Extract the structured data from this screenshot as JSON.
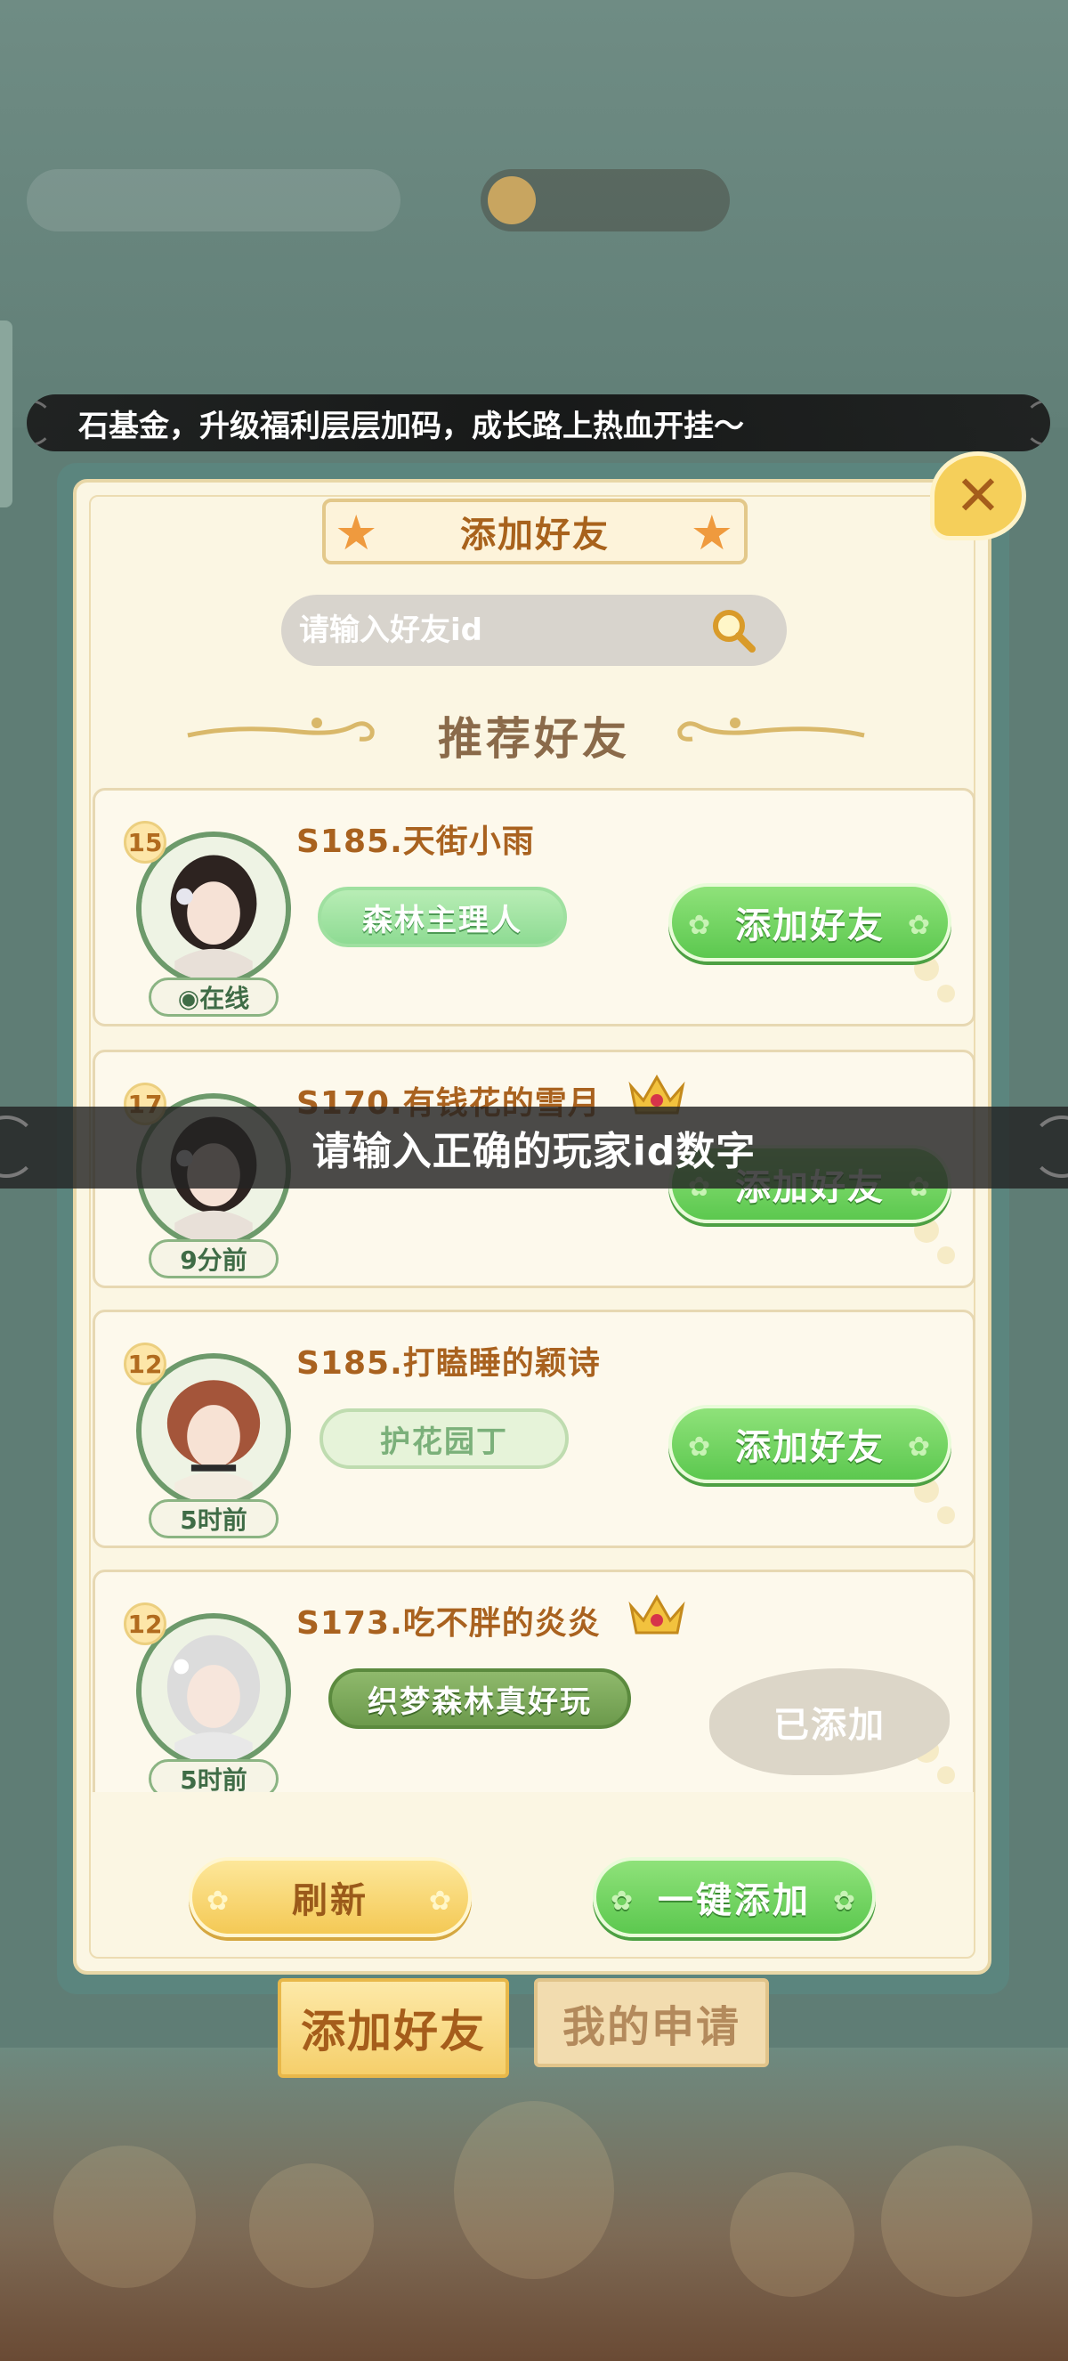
{
  "marquee": {
    "text": "石基金，升级福利层层加码，成长路上热血开挂～"
  },
  "dialog": {
    "title": "添加好友",
    "close_label": "✕",
    "search_placeholder": "请输入好友id",
    "section_title": "推荐好友"
  },
  "friends": [
    {
      "level": "15",
      "name": "S185.天街小雨",
      "title": "森林主理人",
      "status": "◉在线",
      "action": "添加好友",
      "vip": false
    },
    {
      "level": "17",
      "name": "S170.有钱花的雪月",
      "title": "",
      "status": "9分前",
      "action": "添加好友",
      "vip": true
    },
    {
      "level": "12",
      "name": "S185.打瞌睡的颖诗",
      "title": "护花园丁",
      "status": "5时前",
      "action": "添加好友",
      "vip": false
    },
    {
      "level": "12",
      "name": "S173.吃不胖的炎炎",
      "title": "织梦森林真好玩",
      "status": "5时前",
      "action": "已添加",
      "vip": true
    }
  ],
  "buttons": {
    "refresh": "刷新",
    "add_all": "一键添加"
  },
  "tabs": {
    "add_friend": "添加好友",
    "my_requests": "我的申请"
  },
  "toast": {
    "text": "请输入正确的玩家id数字"
  },
  "colors": {
    "accent_green": "#5cc84f",
    "accent_gold": "#f4c955",
    "title_brown": "#a9621f"
  },
  "icons": {
    "search": "search-icon",
    "close": "close-icon",
    "crown": "crown-icon",
    "star": "star-icon"
  }
}
